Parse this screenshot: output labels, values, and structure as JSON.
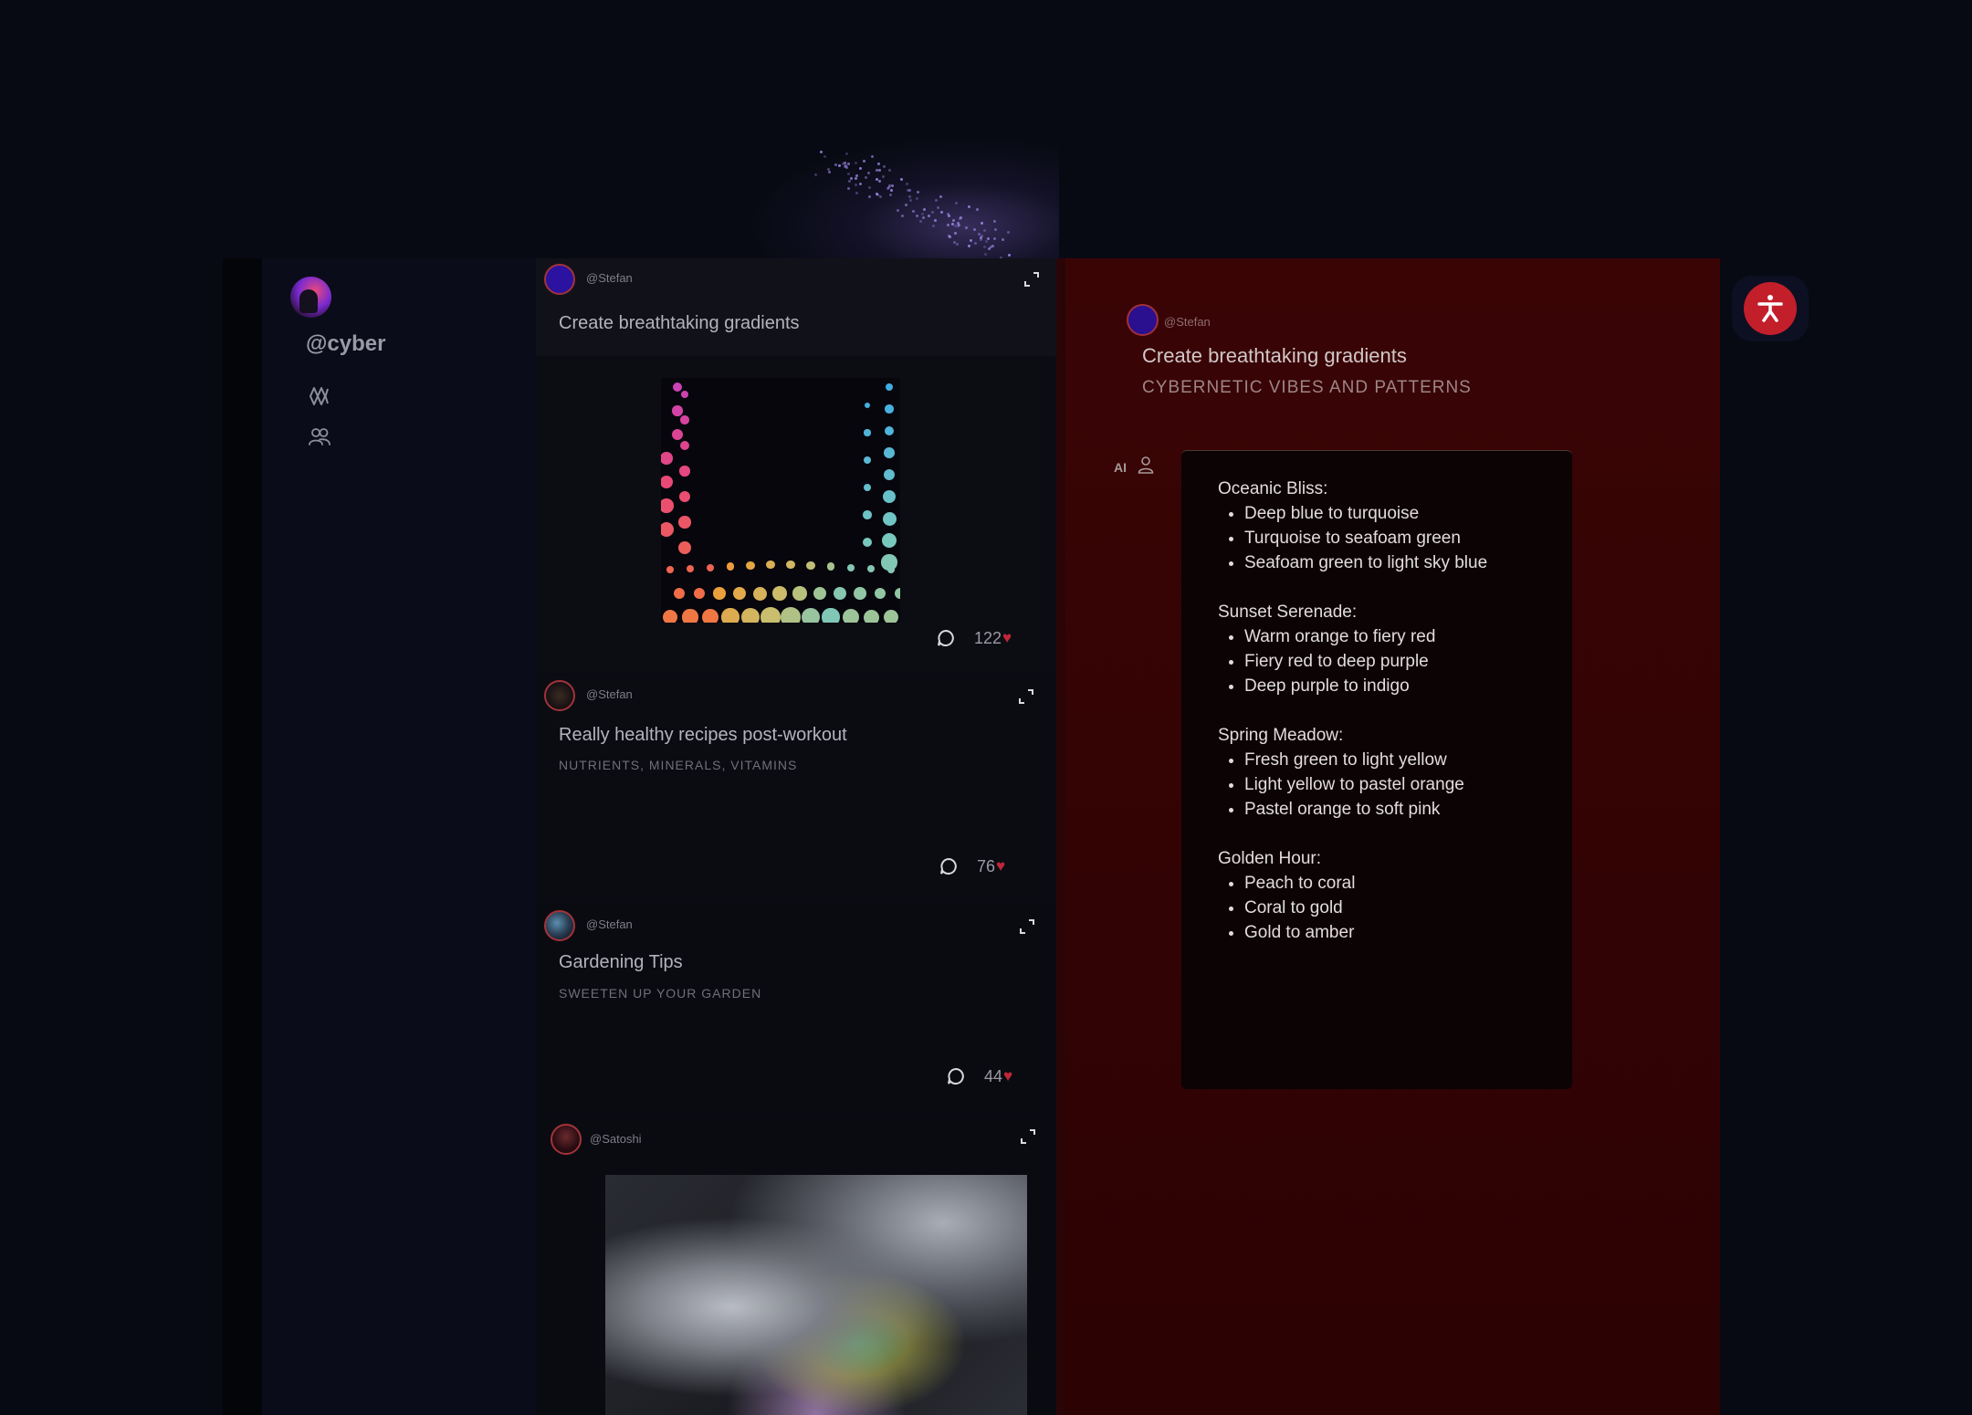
{
  "sidebar": {
    "handle": "@cyber",
    "nav": [
      {
        "icon": "flame-icon"
      },
      {
        "icon": "users-icon"
      }
    ]
  },
  "feed": {
    "posts": [
      {
        "user": "@Stefan",
        "title": "Create breathtaking gradients",
        "subtitle": "",
        "comments_icon": "comment-icon",
        "likes": "122",
        "has_image": true
      },
      {
        "user": "@Stefan",
        "title": "Really healthy recipes post-workout",
        "subtitle": "NUTRIENTS, MINERALS, VITAMINS",
        "likes": "76"
      },
      {
        "user": "@Stefan",
        "title": "Gardening Tips",
        "subtitle": "SWEETEN UP YOUR GARDEN",
        "likes": "44"
      },
      {
        "user": "@Satoshi",
        "title": "",
        "subtitle": "",
        "has_image": true
      }
    ],
    "heart_glyph": "♥"
  },
  "detail": {
    "user": "@Stefan",
    "title": "Create breathtaking gradients",
    "subtitle": "CYBERNETIC VIBES AND PATTERNS",
    "ai_label": "AI",
    "groups": [
      {
        "heading": "Oceanic Bliss:",
        "items": [
          "Deep blue to turquoise",
          "Turquoise to seafoam green",
          "Seafoam green to light sky blue"
        ]
      },
      {
        "heading": "Sunset Serenade:",
        "items": [
          "Warm orange to fiery red",
          "Fiery red to deep purple",
          "Deep purple to indigo"
        ]
      },
      {
        "heading": "Spring Meadow:",
        "items": [
          "Fresh green to light yellow",
          "Light yellow to pastel orange",
          "Pastel orange to soft pink"
        ]
      },
      {
        "heading": "Golden Hour:",
        "items": [
          "Peach to coral",
          "Coral to gold",
          "Gold to amber"
        ]
      }
    ]
  },
  "colors": {
    "background": "#080a13",
    "detail_panel": "#3a0405",
    "accent_red": "#c0263a"
  }
}
